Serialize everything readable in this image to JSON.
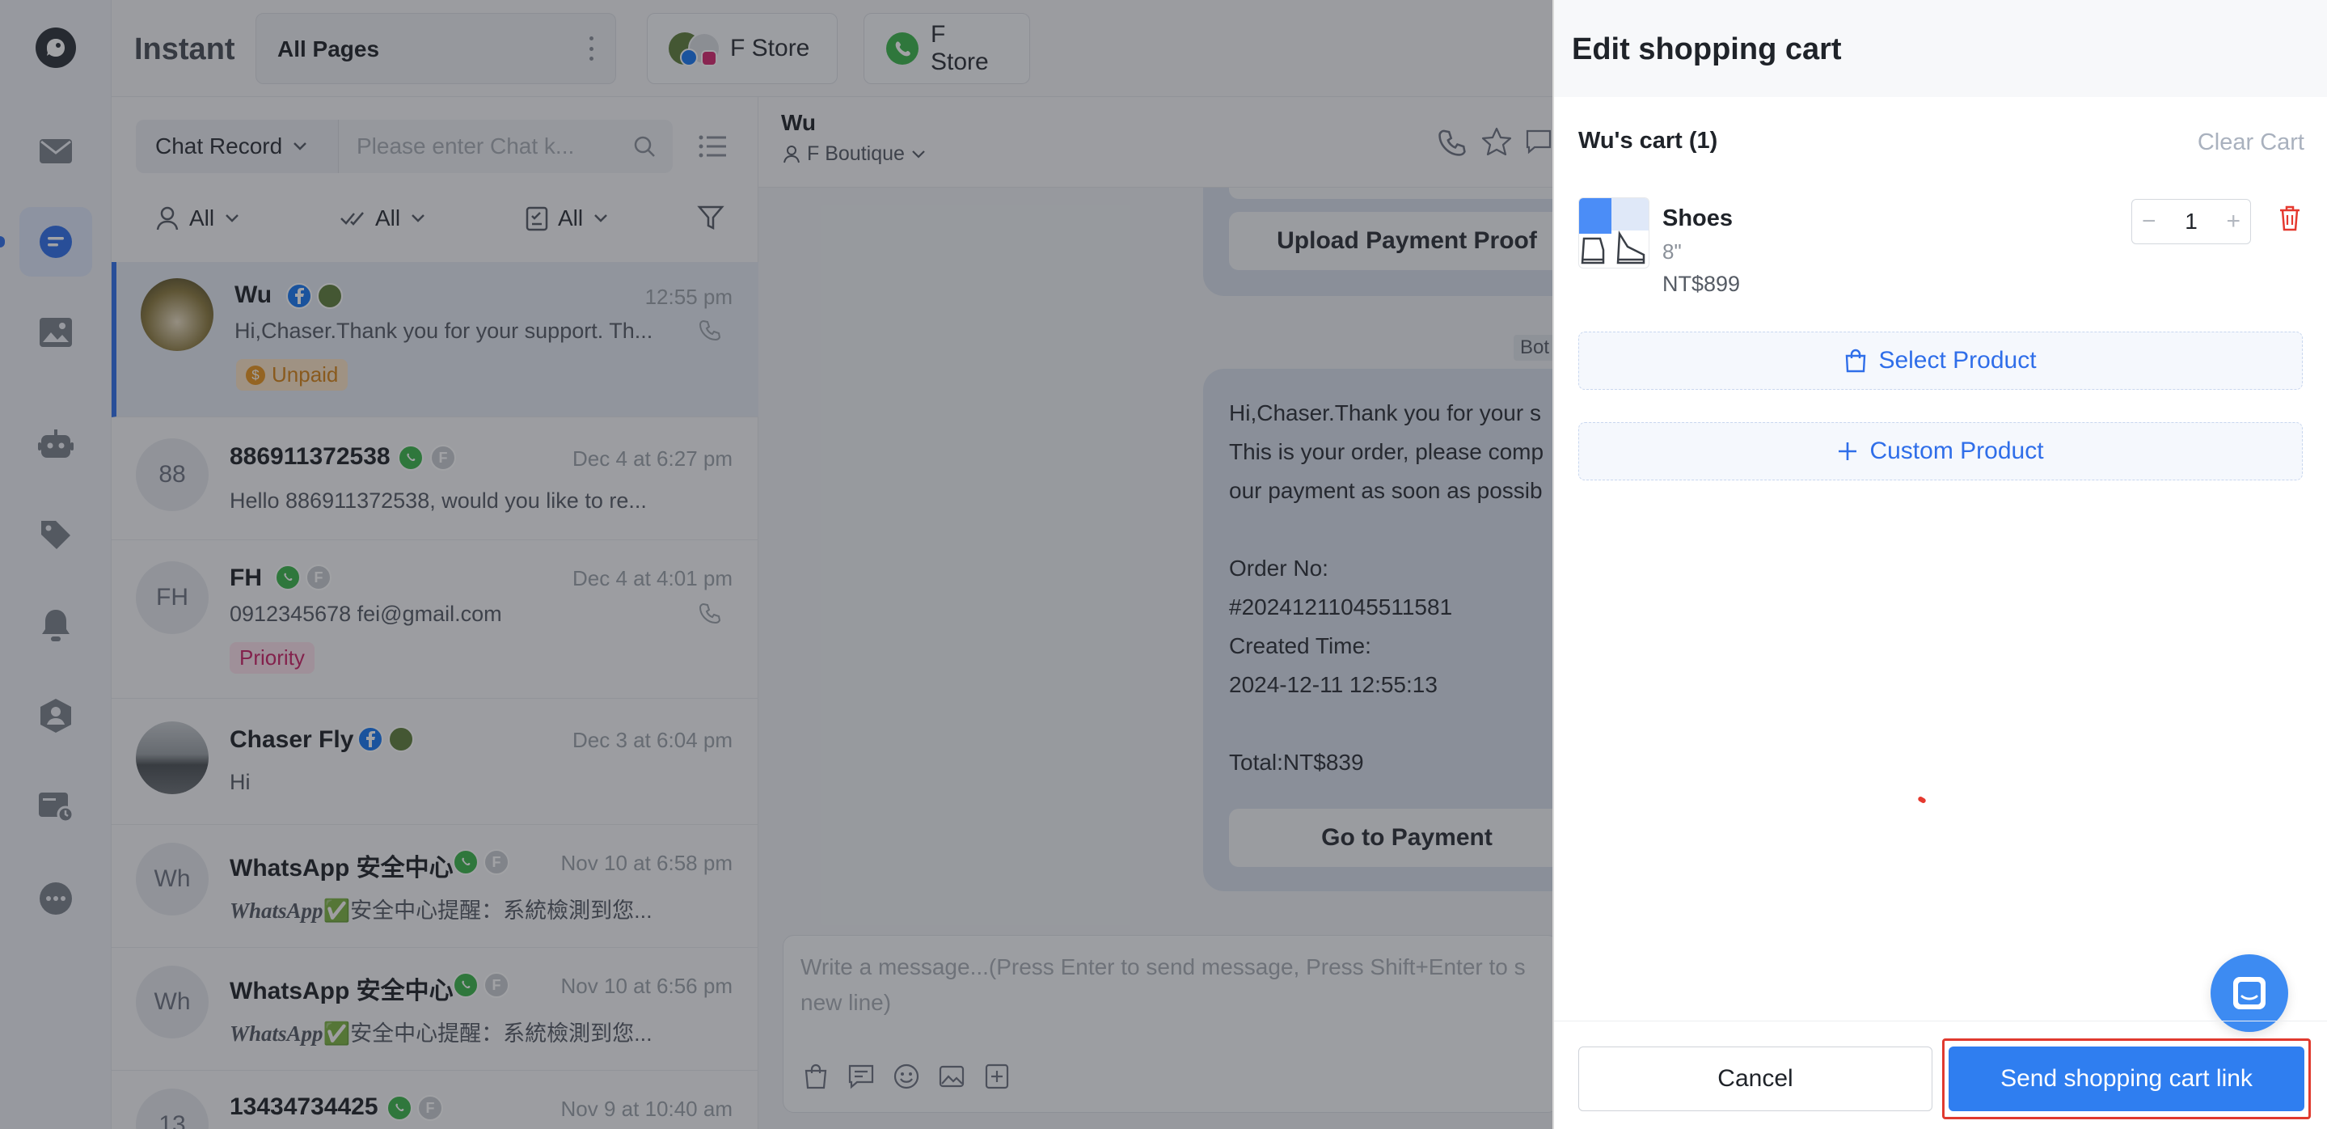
{
  "nav": {
    "icons": [
      "inbox-icon",
      "chat-icon",
      "media-icon",
      "bot-icon",
      "tag-icon",
      "bell-icon",
      "contacts-icon",
      "ticket-icon",
      "more-icon"
    ]
  },
  "topbar": {
    "brand": "Instant",
    "page_select": "All Pages",
    "stores": [
      {
        "label": "F Store"
      },
      {
        "label": "F Store"
      }
    ]
  },
  "list": {
    "filter_type": "Chat Record",
    "search_placeholder": "Please enter Chat k...",
    "filters": [
      {
        "label": "All"
      },
      {
        "label": "All"
      },
      {
        "label": "All"
      }
    ],
    "rows": [
      {
        "name": "Wu",
        "time": "12:55 pm",
        "preview": "Hi,Chaser.Thank you for your support. Th...",
        "badge": "Unpaid"
      },
      {
        "initials": "88",
        "name": "886911372538",
        "time": "Dec 4 at 6:27 pm",
        "preview": "Hello 886911372538, would you like to re..."
      },
      {
        "initials": "FH",
        "name": "FH",
        "time": "Dec 4 at 4:01 pm",
        "preview": "0912345678 fei@gmail.com",
        "badge": "Priority"
      },
      {
        "name": "Chaser Fly",
        "time": "Dec 3 at 6:04 pm",
        "preview": "Hi"
      },
      {
        "initials": "Wh",
        "name": "WhatsApp 安全中心",
        "time": "Nov 10 at 6:58 pm",
        "preview_brand": "WhatsApp",
        "preview": "✅安全中心提醒：系統檢測到您..."
      },
      {
        "initials": "Wh",
        "name": "WhatsApp 安全中心",
        "time": "Nov 10 at 6:56 pm",
        "preview_brand": "WhatsApp",
        "preview": "✅安全中心提醒：系統檢測到您..."
      },
      {
        "initials": "13",
        "name": "13434734425",
        "time": "Nov 9 at 10:40 am"
      }
    ]
  },
  "chat": {
    "contact_name": "Wu",
    "page_name": "F Boutique",
    "bot_tag": "Bot",
    "upload_button": "Upload Payment Proof",
    "message_lines": "Hi,Chaser.Thank you for your s\nThis is your order, please comp\nour payment as soon as possib\n\nOrder No:\n#20241211045511581\nCreated Time:\n2024-12-11 12:55:13\n\nTotal:NT$839",
    "pay_button": "Go to Payment",
    "composer_placeholder": "Write a message...(Press Enter to send message, Press Shift+Enter to s",
    "composer_placeholder_line2": "new line)"
  },
  "drawer": {
    "title": "Edit shopping cart",
    "cart_label": "Wu's cart (1)",
    "clear_label": "Clear Cart",
    "item": {
      "name": "Shoes",
      "variant": "8\"",
      "price": "NT$899",
      "qty": "1"
    },
    "select_product": "Select Product",
    "custom_product": "Custom Product",
    "cancel": "Cancel",
    "send": "Send shopping cart link"
  },
  "colors": {
    "accent": "#2f6ee9",
    "whatsapp": "#3bb54a",
    "facebook": "#1877f2",
    "danger": "#e5392f",
    "highlight": "#e03a2f"
  }
}
